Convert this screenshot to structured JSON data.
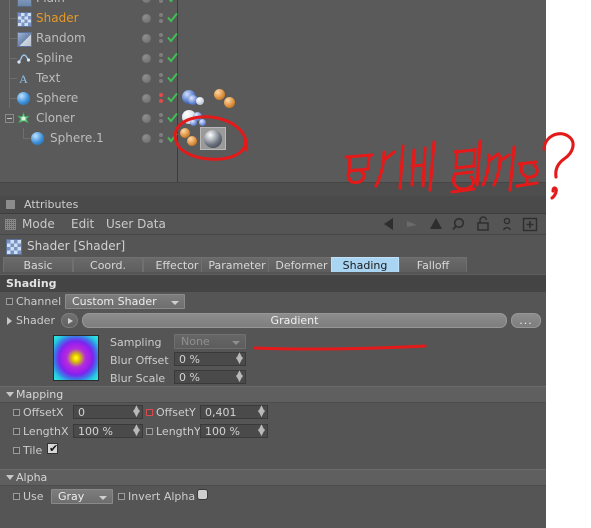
{
  "object_manager": {
    "rows": [
      {
        "name": "Plain",
        "icon": "plain-effector-icon",
        "selected": false,
        "indent": 1,
        "cut": true
      },
      {
        "name": "Shader",
        "icon": "shader-effector-icon",
        "selected": true,
        "indent": 1
      },
      {
        "name": "Random",
        "icon": "random-effector-icon",
        "selected": false,
        "indent": 1
      },
      {
        "name": "Spline",
        "icon": "spline-effector-icon",
        "selected": false,
        "indent": 1
      },
      {
        "name": "Text",
        "icon": "text-object-icon",
        "selected": false,
        "indent": 1
      },
      {
        "name": "Sphere",
        "icon": "sphere-object-icon",
        "selected": false,
        "indent": 1
      },
      {
        "name": "Cloner",
        "icon": "cloner-object-icon",
        "selected": false,
        "indent": 1,
        "expandable": true
      },
      {
        "name": "Sphere.1",
        "icon": "sphere-object-icon",
        "selected": false,
        "indent": 2
      }
    ],
    "visibility_dots": {
      "editor_label": "editor-visibility-dot",
      "render_label": "render-visibility-dot",
      "enabled_check": "enabled-check-icon"
    }
  },
  "attributes": {
    "window_title": "Attributes",
    "menu": [
      "Mode",
      "Edit",
      "User Data"
    ],
    "toolbar_icons": [
      "back-arrow-icon",
      "forward-arrow-icon",
      "up-arrow-icon",
      "search-icon",
      "lock-icon",
      "user-icon",
      "add-box-icon"
    ],
    "object_line": "Shader [Shader]",
    "tabs": [
      {
        "label": "Basic",
        "active": false
      },
      {
        "label": "Coord.",
        "active": false
      },
      {
        "label": "Effector",
        "active": false
      },
      {
        "label": "Parameter",
        "active": false
      },
      {
        "label": "Deformer",
        "active": false
      },
      {
        "label": "Shading",
        "active": true
      },
      {
        "label": "Falloff",
        "active": false
      }
    ],
    "shading": {
      "header": "Shading",
      "channel_label": "Channel",
      "channel_value": "Custom Shader",
      "shader_label": "Shader",
      "shader_value": "Gradient",
      "shader_more_button": "...",
      "sampling_label": "Sampling",
      "sampling_value": "None",
      "blur_offset_label": "Blur Offset",
      "blur_offset_value": "0 %",
      "blur_scale_label": "Blur Scale",
      "blur_scale_value": "0 %"
    },
    "mapping": {
      "header": "Mapping",
      "offsetx_label": "OffsetX",
      "offsetx_value": "0",
      "offsety_label": "OffsetY",
      "offsety_value": "0,401",
      "offsety_keyed": true,
      "lengthx_label": "LengthX",
      "lengthx_value": "100 %",
      "lengthy_label": "LengthY",
      "lengthy_value": "100 %",
      "tile_label": "Tile",
      "tile_checked": true,
      "tile_mark": "✔"
    },
    "alpha": {
      "header": "Alpha",
      "use_label": "Use",
      "use_value": "Gray",
      "invert_label": "Invert Alpha",
      "invert_checked": false
    }
  },
  "annotation": {
    "text": "동시에 될까요?",
    "color": "#e41a1a",
    "marks": [
      "circle-around-tag",
      "underline-under-shader-field",
      "handwritten-question"
    ]
  },
  "colors": {
    "panel_bg": "#555555",
    "panel_dark": "#444444",
    "accent_tab": "#a9d4f2",
    "selected_text": "#e59a28",
    "annotation_red": "#e41a1a",
    "check_green": "#3fbf55",
    "red_dot": "#e04b4b"
  }
}
